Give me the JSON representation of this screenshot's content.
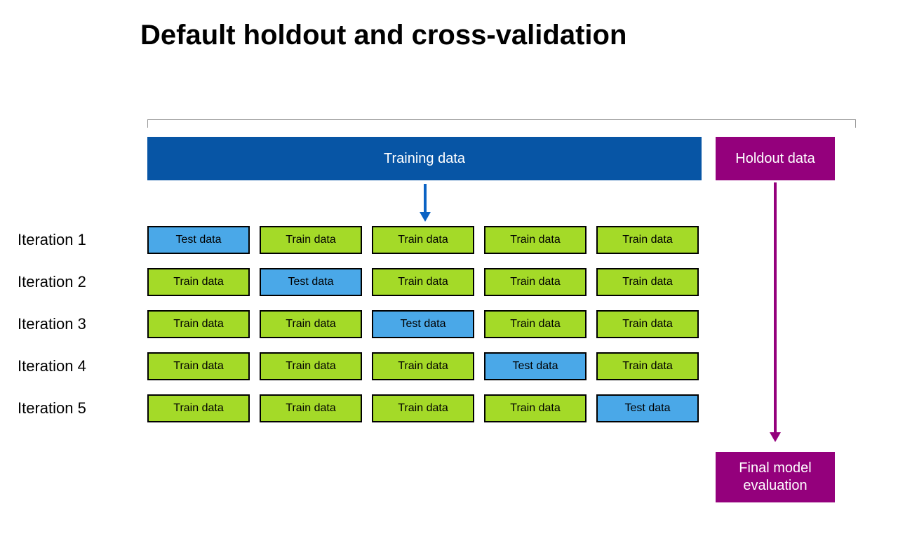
{
  "title": "Default holdout and cross-validation",
  "training_label": "Training data",
  "holdout_label": "Holdout data",
  "final_label": "Final model evaluation",
  "fold_labels": {
    "train": "Train data",
    "test": "Test data"
  },
  "iterations": [
    {
      "label": "Iteration 1",
      "folds": [
        "test",
        "train",
        "train",
        "train",
        "train"
      ]
    },
    {
      "label": "Iteration 2",
      "folds": [
        "train",
        "test",
        "train",
        "train",
        "train"
      ]
    },
    {
      "label": "Iteration 3",
      "folds": [
        "train",
        "train",
        "test",
        "train",
        "train"
      ]
    },
    {
      "label": "Iteration 4",
      "folds": [
        "train",
        "train",
        "train",
        "test",
        "train"
      ]
    },
    {
      "label": "Iteration 5",
      "folds": [
        "train",
        "train",
        "train",
        "train",
        "test"
      ]
    }
  ]
}
